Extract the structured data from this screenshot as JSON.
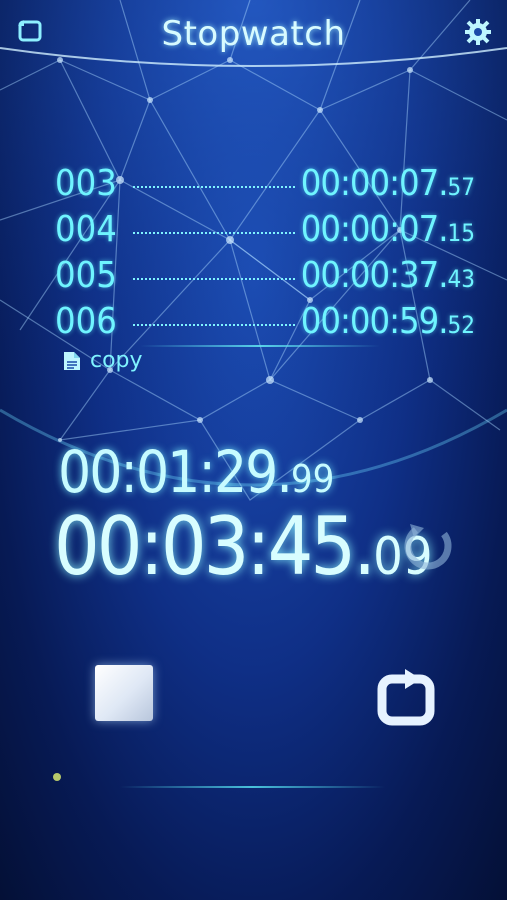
{
  "header": {
    "title": "Stopwatch",
    "left_icon": "rotate-screen-icon",
    "right_icon": "gear-icon"
  },
  "laps": [
    {
      "num": "003",
      "time_main": "00:00:07.",
      "time_frac": "57"
    },
    {
      "num": "004",
      "time_main": "00:00:07.",
      "time_frac": "15"
    },
    {
      "num": "005",
      "time_main": "00:00:37.",
      "time_frac": "43"
    },
    {
      "num": "006",
      "time_main": "00:00:59.",
      "time_frac": "52"
    }
  ],
  "copy": {
    "label": "copy",
    "icon": "document-icon"
  },
  "lap_timer": {
    "main": "00:01:29.",
    "frac": "99"
  },
  "total_timer": {
    "main": "00:03:45.",
    "frac": "09"
  },
  "controls": {
    "reset_icon": "reset-icon",
    "stop_icon": "stop-icon",
    "lap_icon": "lap-repeat-icon"
  },
  "colors": {
    "accent": "#6ff4ff",
    "background": "#0f2f86"
  }
}
